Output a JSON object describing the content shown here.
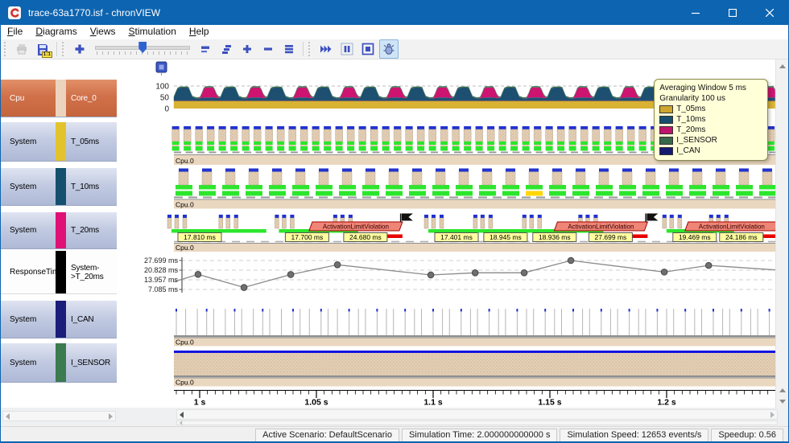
{
  "window": {
    "title": "trace-63a1770.isf - chronVIEW",
    "controls": [
      "minimize",
      "maximize",
      "close"
    ]
  },
  "menu": {
    "items": [
      "File",
      "Diagrams",
      "Views",
      "Stimulation",
      "Help"
    ]
  },
  "toolbar": {
    "buttons": [
      {
        "name": "print",
        "disabled": true
      },
      {
        "name": "save-scale",
        "badge": "1:1"
      },
      {
        "sep": true
      },
      {
        "name": "zoom-in"
      },
      {
        "slider": true,
        "name": "zoom-slider",
        "value": 46
      },
      {
        "name": "collapse-row"
      },
      {
        "name": "expand-steps"
      },
      {
        "name": "add-item"
      },
      {
        "name": "remove-item"
      },
      {
        "name": "row-list"
      },
      {
        "sep": true
      },
      {
        "name": "run"
      },
      {
        "name": "pause"
      },
      {
        "name": "stop"
      },
      {
        "name": "pointer-mode",
        "active": true
      }
    ]
  },
  "sidebar": {
    "rows": [
      {
        "type": "Cpu",
        "name": "Core_0",
        "style": "orange",
        "strip": "#ecd3bd",
        "text_color": "#ffffff"
      },
      {
        "type": "System",
        "name": "T_05ms",
        "style": "blue",
        "strip": "#e3c32d",
        "text_color": "#000000"
      },
      {
        "type": "System",
        "name": "T_10ms",
        "style": "blue",
        "strip": "#14506e",
        "text_color": "#000000"
      },
      {
        "type": "System",
        "name": "T_20ms",
        "style": "blue",
        "strip": "#df1177",
        "text_color": "#000000"
      },
      {
        "type": "ResponseTime",
        "name": "System->T_20ms",
        "style": "white",
        "strip": "#000000",
        "text_color": "#000000"
      },
      {
        "type": "System",
        "name": "I_CAN",
        "style": "blue",
        "strip": "#1a1d7a",
        "text_color": "#000000"
      },
      {
        "type": "System",
        "name": "I_SENSOR",
        "style": "blue",
        "strip": "#3c7a50",
        "text_color": "#000000"
      }
    ]
  },
  "chart_data": [
    {
      "id": "cpu_load",
      "type": "area",
      "row": "Cpu.Core_0",
      "averaging_text": "Averaging Window 5 ms",
      "granularity_text": "Granularity 100 us",
      "legend_items": [
        {
          "label": "T_05ms",
          "color": "#cfa62e"
        },
        {
          "label": "T_10ms",
          "color": "#174f6e"
        },
        {
          "label": "T_20ms",
          "color": "#c0146c"
        },
        {
          "label": "I_SENSOR",
          "color": "#38684a"
        },
        {
          "label": "I_CAN",
          "color": "#161a70"
        }
      ],
      "y_ticks": [
        100,
        50,
        0
      ],
      "ylim": [
        0,
        110
      ],
      "x_range_s": [
        0.9889,
        1.2466
      ],
      "stack_order": [
        "T_05ms",
        "I_CAN",
        "T_10ms",
        "T_20ms",
        "I_SENSOR"
      ],
      "colors": {
        "T_05ms": "#d9b233",
        "I_CAN": "#1a1a70",
        "T_10ms": "#1c4f70",
        "T_20ms": "#cc1470",
        "I_SENSOR": "#3d7050"
      },
      "period_s": 0.02,
      "keyframes": [
        {
          "t": 0.0,
          "T_05ms": 34,
          "I_CAN": 3,
          "T_10ms": 8,
          "T_20ms": 0,
          "I_SENSOR": 5
        },
        {
          "t": 0.05,
          "T_05ms": 34,
          "I_CAN": 3,
          "T_10ms": 10,
          "T_20ms": 20,
          "I_SENSOR": 5
        },
        {
          "t": 0.1,
          "T_05ms": 34,
          "I_CAN": 3,
          "T_10ms": 12,
          "T_20ms": 45,
          "I_SENSOR": 5
        },
        {
          "t": 0.3,
          "T_05ms": 34,
          "I_CAN": 3,
          "T_10ms": 12,
          "T_20ms": 45,
          "I_SENSOR": 5
        },
        {
          "t": 0.38,
          "T_05ms": 34,
          "I_CAN": 3,
          "T_10ms": 10,
          "T_20ms": 5,
          "I_SENSOR": 5
        },
        {
          "t": 0.44,
          "T_05ms": 34,
          "I_CAN": 3,
          "T_10ms": 9,
          "T_20ms": 0,
          "I_SENSOR": 5
        },
        {
          "t": 0.52,
          "T_05ms": 34,
          "I_CAN": 3,
          "T_10ms": 50,
          "T_20ms": 0,
          "I_SENSOR": 5
        },
        {
          "t": 0.58,
          "T_05ms": 34,
          "I_CAN": 3,
          "T_10ms": 56,
          "T_20ms": 0,
          "I_SENSOR": 5
        },
        {
          "t": 0.76,
          "T_05ms": 34,
          "I_CAN": 3,
          "T_10ms": 56,
          "T_20ms": 0,
          "I_SENSOR": 5
        },
        {
          "t": 0.84,
          "T_05ms": 34,
          "I_CAN": 3,
          "T_10ms": 15,
          "T_20ms": 0,
          "I_SENSOR": 5
        },
        {
          "t": 0.92,
          "T_05ms": 34,
          "I_CAN": 3,
          "T_10ms": 8,
          "T_20ms": 0,
          "I_SENSOR": 5
        }
      ]
    },
    {
      "id": "t05",
      "type": "gantt",
      "task": "T_05ms",
      "core": "Cpu.0",
      "period_s": 0.005,
      "colors": {
        "cap": "#2233cf",
        "body": "#dcc6ac",
        "run": "#2ce62c"
      }
    },
    {
      "id": "t10",
      "type": "gantt",
      "task": "T_10ms",
      "core": "Cpu.0",
      "period_s": 0.01,
      "highlight_t": 1.14,
      "highlight_color": "#ffd700",
      "colors": {
        "cap": "#2233cf",
        "body": "#dcc6ac",
        "run": "#2ce62c"
      }
    },
    {
      "id": "t20",
      "type": "gantt-response",
      "task": "T_20ms",
      "core": "Cpu.0",
      "period_s": 0.02,
      "violation_text": "ActivationLimitViolation",
      "colors": {
        "ok": "#2ce62c",
        "violation": "#e80000",
        "label_bg": "#ffffa0",
        "label_border": "#555555",
        "callout_bg": "#ef8576",
        "callout_border": "#a00000"
      },
      "responses": [
        {
          "t": 1.0,
          "label": "17.810 ms",
          "violation": false
        },
        {
          "t": 1.022,
          "label": "",
          "violation": false
        },
        {
          "t": 1.046,
          "label": "17.700 ms",
          "violation": false
        },
        {
          "t": 1.071,
          "label": "24.680 ms",
          "violation": true
        },
        {
          "t": 1.11,
          "label": "17.401 ms",
          "violation": false
        },
        {
          "t": 1.131,
          "label": "18.945 ms",
          "violation": false
        },
        {
          "t": 1.152,
          "label": "18.936 ms",
          "violation": false
        },
        {
          "t": 1.176,
          "label": "27.699 ms",
          "violation": true
        },
        {
          "t": 1.212,
          "label": "19.469 ms",
          "violation": false
        },
        {
          "t": 1.232,
          "label": "24.186 ms",
          "violation": true
        }
      ]
    },
    {
      "id": "rt",
      "type": "line",
      "name": "ResponseTime System->T_20ms",
      "unit": "ms",
      "y_ticks": [
        {
          "label": "27.699 ms",
          "value": 27.699
        },
        {
          "label": "20.828 ms",
          "value": 20.828
        },
        {
          "label": "13.957 ms",
          "value": 13.957
        },
        {
          "label": "7.085 ms",
          "value": 7.085
        }
      ],
      "points": [
        {
          "t": 0.9889,
          "value": 12.5,
          "marker": false
        },
        {
          "t": 0.9993,
          "value": 17.81,
          "marker": true
        },
        {
          "t": 1.019,
          "value": 8.5,
          "marker": true
        },
        {
          "t": 1.039,
          "value": 17.7,
          "marker": true
        },
        {
          "t": 1.059,
          "value": 24.68,
          "marker": true
        },
        {
          "t": 1.099,
          "value": 17.401,
          "marker": true
        },
        {
          "t": 1.118,
          "value": 18.945,
          "marker": true
        },
        {
          "t": 1.139,
          "value": 18.936,
          "marker": true
        },
        {
          "t": 1.159,
          "value": 27.699,
          "marker": true
        },
        {
          "t": 1.199,
          "value": 19.469,
          "marker": true
        },
        {
          "t": 1.218,
          "value": 24.186,
          "marker": true
        },
        {
          "t": 1.2466,
          "value": 21.0,
          "marker": false
        }
      ]
    },
    {
      "id": "ican",
      "type": "event",
      "name": "I_CAN",
      "core": "Cpu.0",
      "events": [
        0.99,
        0.994,
        0.999,
        1.003,
        1.006,
        1.011,
        1.015,
        1.018,
        1.023,
        1.027,
        1.03,
        1.035,
        1.04,
        1.043,
        1.047,
        1.052,
        1.055,
        1.059,
        1.064,
        1.068,
        1.071,
        1.076,
        1.08,
        1.083,
        1.088,
        1.092,
        1.095,
        1.1,
        1.104,
        1.107,
        1.112,
        1.116,
        1.119,
        1.124,
        1.128,
        1.131,
        1.136,
        1.14,
        1.143,
        1.148,
        1.152,
        1.155,
        1.16,
        1.164,
        1.167,
        1.172,
        1.176,
        1.179,
        1.184,
        1.188,
        1.191,
        1.196,
        1.2,
        1.203,
        1.208,
        1.212,
        1.215,
        1.22,
        1.224,
        1.227,
        1.232,
        1.236,
        1.239,
        1.244
      ]
    },
    {
      "id": "isensor",
      "type": "state",
      "name": "I_SENSOR",
      "core": "Cpu.0",
      "state_color": "#1414e0"
    },
    {
      "id": "taxis",
      "type": "axis",
      "unit": "s",
      "tick_labels": [
        "1 s",
        "1.05 s",
        "1.1 s",
        "1.15 s",
        "1.2 s"
      ],
      "tick_values": [
        1,
        1.05,
        1.1,
        1.15,
        1.2
      ],
      "x_range_s": [
        0.9889,
        1.2466
      ]
    }
  ],
  "statusbar": {
    "sections": [
      "Active Scenario: DefaultScenario",
      "Simulation Time: 2.000000000000 s",
      "Simulation Speed: 12653 events/s",
      "Speedup: 0.56"
    ]
  },
  "colors": {
    "titlebar": "#0d64b0",
    "toolbar_icon": "#3c50c0",
    "track_tan": "#e3cfb6",
    "strip_tan": "#ead7bf",
    "selection_bg": "#cfe4f7"
  }
}
